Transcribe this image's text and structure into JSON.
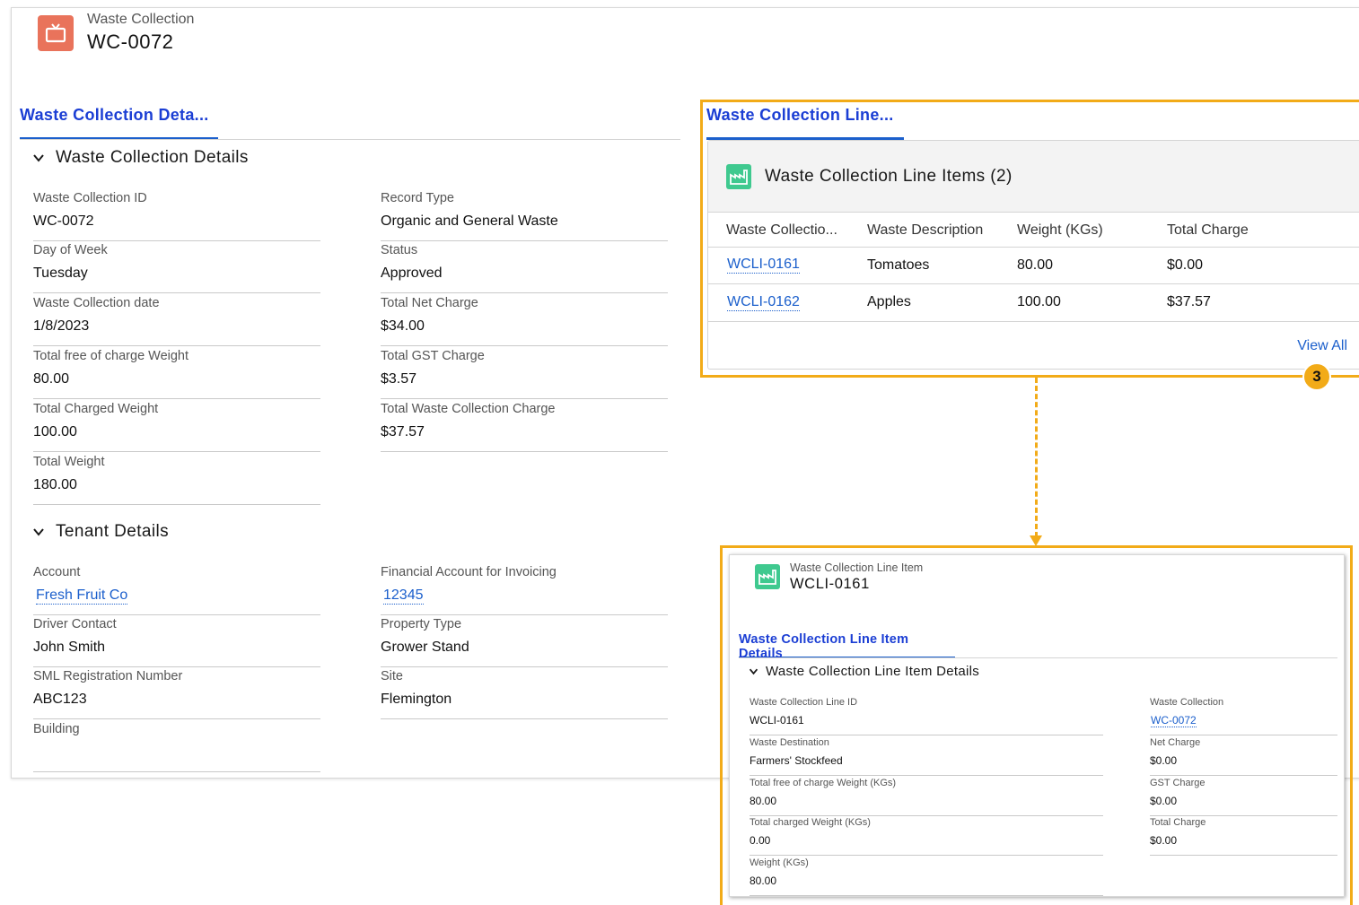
{
  "record": {
    "object_label": "Waste Collection",
    "name": "WC-0072",
    "icon": "tv-icon"
  },
  "tab_left": {
    "label": "Waste Collection Deta..."
  },
  "sections": {
    "details_title": "Waste Collection Details",
    "tenant_title": "Tenant Details"
  },
  "details": {
    "left": [
      {
        "label": "Waste Collection ID",
        "value": "WC-0072"
      },
      {
        "label": "Day of Week",
        "value": "Tuesday"
      },
      {
        "label": "Waste Collection date",
        "value": "1/8/2023"
      },
      {
        "label": "Total free of charge Weight",
        "value": "80.00"
      },
      {
        "label": "Total Charged Weight",
        "value": "100.00"
      },
      {
        "label": "Total Weight",
        "value": "180.00"
      }
    ],
    "right": [
      {
        "label": "Record Type",
        "value": "Organic and General Waste"
      },
      {
        "label": "Status",
        "value": "Approved"
      },
      {
        "label": "Total Net Charge",
        "value": "$34.00"
      },
      {
        "label": "Total GST Charge",
        "value": "$3.57"
      },
      {
        "label": "Total Waste Collection Charge",
        "value": "$37.57"
      }
    ]
  },
  "tenant": {
    "left": [
      {
        "label": "Account",
        "value": "Fresh Fruit Co"
      },
      {
        "label": "Driver Contact",
        "value": "John Smith"
      },
      {
        "label": "SML Registration Number",
        "value": "ABC123"
      },
      {
        "label": "Building",
        "value": ""
      }
    ],
    "right": [
      {
        "label": "Financial Account for Invoicing",
        "value": "12345"
      },
      {
        "label": "Property Type",
        "value": "Grower Stand"
      },
      {
        "label": "Site",
        "value": "Flemington"
      }
    ]
  },
  "related": {
    "tab_label": "Waste Collection Line...",
    "title": "Waste Collection Line Items (2)",
    "icon": "factory-icon",
    "columns": [
      "Waste Collectio...",
      "Waste Description",
      "Weight (KGs)",
      "Total Charge"
    ],
    "rows": [
      [
        "WCLI-0161",
        "Tomatoes",
        "80.00",
        "$0.00"
      ],
      [
        "WCLI-0162",
        "Apples",
        "100.00",
        "$37.57"
      ]
    ],
    "view_all": "View All",
    "callout_number": "3",
    "highlight_color": "#f2ab18"
  },
  "detail_card": {
    "object_label": "Waste Collection Line Item",
    "name": "WCLI-0161",
    "tab_label": "Waste Collection Line Item Details",
    "section_title": "Waste Collection Line Item Details",
    "left": [
      {
        "label": "Waste Collection Line ID",
        "value": "WCLI-0161"
      },
      {
        "label": "Waste Destination",
        "value": "Farmers' Stockfeed"
      },
      {
        "label": "Total free of charge Weight (KGs)",
        "value": "80.00"
      },
      {
        "label": "Total charged Weight (KGs)",
        "value": "0.00"
      },
      {
        "label": "Weight (KGs)",
        "value": "80.00"
      }
    ],
    "right": [
      {
        "label": "Waste Collection",
        "value": "WC-0072"
      },
      {
        "label": "Net Charge",
        "value": "$0.00"
      },
      {
        "label": "GST Charge",
        "value": "$0.00"
      },
      {
        "label": "Total Charge",
        "value": "$0.00"
      }
    ]
  }
}
